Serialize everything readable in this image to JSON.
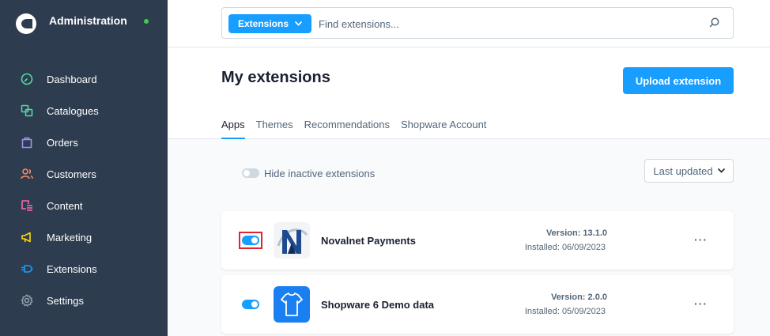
{
  "app": {
    "title": "Administration"
  },
  "sidebar": {
    "items": [
      {
        "label": "Dashboard",
        "icon": "dashboard-icon",
        "color": "#57d9a3"
      },
      {
        "label": "Catalogues",
        "icon": "catalogues-icon",
        "color": "#57d9a3"
      },
      {
        "label": "Orders",
        "icon": "orders-icon",
        "color": "#a092f0"
      },
      {
        "label": "Customers",
        "icon": "customers-icon",
        "color": "#f88962"
      },
      {
        "label": "Content",
        "icon": "content-icon",
        "color": "#ff68b4"
      },
      {
        "label": "Marketing",
        "icon": "marketing-icon",
        "color": "#ffd700"
      },
      {
        "label": "Extensions",
        "icon": "extensions-icon",
        "color": "#189eff"
      },
      {
        "label": "Settings",
        "icon": "settings-icon",
        "color": "#9aa8b5"
      }
    ]
  },
  "search": {
    "scope": "Extensions",
    "placeholder": "Find extensions..."
  },
  "header": {
    "title": "My extensions",
    "upload_label": "Upload extension",
    "tabs": [
      "Apps",
      "Themes",
      "Recommendations",
      "Shopware Account"
    ],
    "active_tab": "Apps"
  },
  "filters": {
    "hide_inactive_label": "Hide inactive extensions",
    "hide_inactive": false,
    "sort_label": "Last updated"
  },
  "extensions": [
    {
      "name": "Novalnet Payments",
      "version": "Version: 13.1.0",
      "installed": "Installed: 06/09/2023",
      "active": true,
      "logo": "novalnet-logo",
      "highlighted": true
    },
    {
      "name": "Shopware 6 Demo data",
      "version": "Version: 2.0.0",
      "installed": "Installed: 05/09/2023",
      "active": true,
      "logo": "shirt-icon",
      "highlighted": false
    }
  ],
  "colors": {
    "accent": "#189eff",
    "sidebar_bg": "#2d3c4f",
    "highlight": "#e3242b",
    "status_online": "#37d046"
  },
  "menu_label": "···"
}
